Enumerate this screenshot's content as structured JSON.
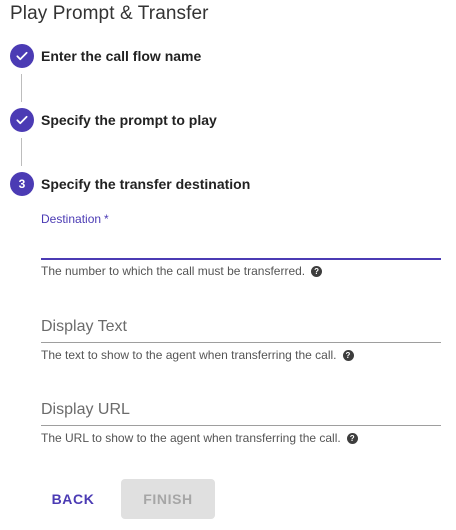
{
  "page": {
    "title": "Play Prompt & Transfer"
  },
  "steps": [
    {
      "label": "Enter the call flow name",
      "state": "completed",
      "icon": "check-icon"
    },
    {
      "label": "Specify the prompt to play",
      "state": "completed",
      "icon": "check-icon"
    },
    {
      "label": "Specify the transfer destination",
      "state": "active",
      "number": "3"
    }
  ],
  "form": {
    "destination": {
      "label": "Destination",
      "required_marker": "*",
      "value": "",
      "hint": "The number to which the call must be transferred."
    },
    "display_text": {
      "placeholder": "Display Text",
      "value": "",
      "hint": "The text to show to the agent when transferring the call."
    },
    "display_url": {
      "placeholder": "Display URL",
      "value": "",
      "hint": "The URL to show to the agent when transferring the call."
    },
    "help_glyph": "?"
  },
  "actions": {
    "back_label": "BACK",
    "finish_label": "FINISH"
  },
  "colors": {
    "accent": "#4b3bb4",
    "disabled_bg": "#e0e0e0",
    "disabled_text": "#a6a6a6"
  }
}
